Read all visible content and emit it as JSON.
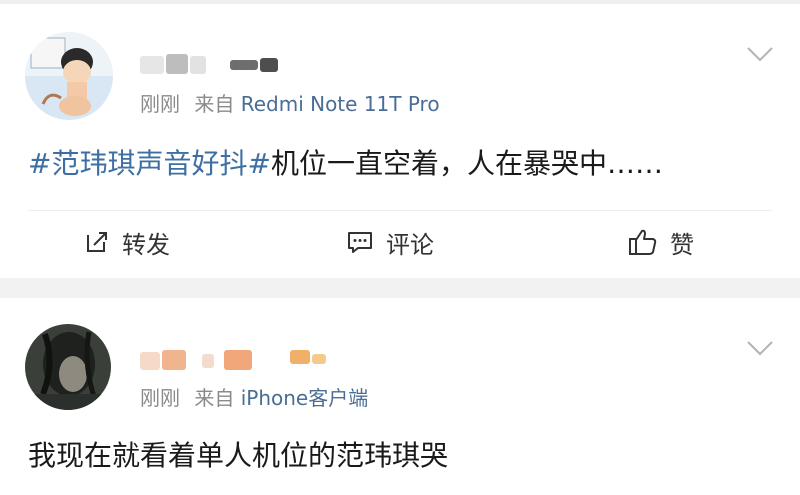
{
  "posts": [
    {
      "time": "刚刚",
      "from_label": "来自",
      "source": "Redmi Note 11T Pro",
      "hashtag": "#范玮琪声音好抖#",
      "text": "机位一直空着，人在暴哭中……"
    },
    {
      "time": "刚刚",
      "from_label": "来自",
      "source": "iPhone客户端",
      "text": "我现在就看着单人机位的范玮琪哭"
    }
  ],
  "actions": {
    "repost_label": "转发",
    "comment_label": "评论",
    "like_label": "赞"
  },
  "colors": {
    "hashtag": "#3e6fa3",
    "source_link": "#4a6d96",
    "meta_text": "#8a8a8a",
    "separator_bg": "#f2f2f2"
  },
  "icons": [
    "repost-icon",
    "comment-icon",
    "like-icon",
    "chevron-down-icon"
  ]
}
